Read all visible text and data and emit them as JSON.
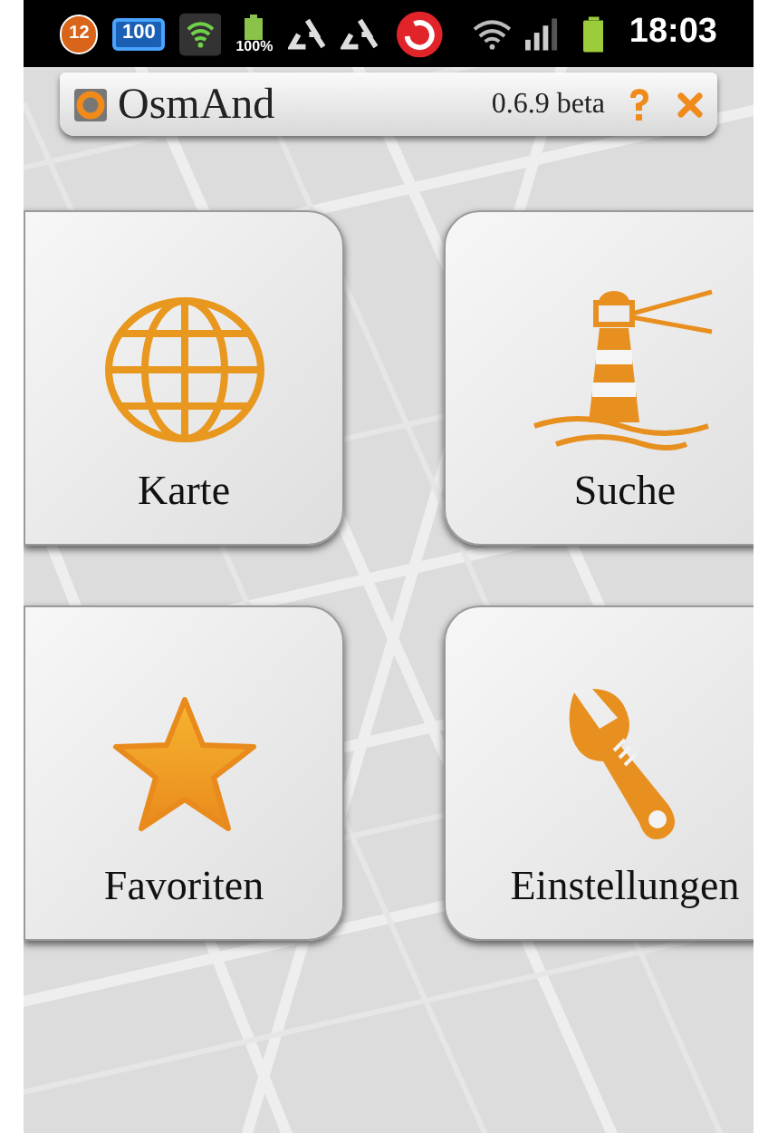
{
  "status_bar": {
    "notification_count": "12",
    "battery_app_level": "100",
    "battery_percent": "100%",
    "time": "18:03"
  },
  "title_bar": {
    "title": "OsmAnd",
    "version": "0.6.9 beta"
  },
  "tiles": [
    {
      "kind": "map",
      "label": "Karte"
    },
    {
      "kind": "search",
      "label": "Suche"
    },
    {
      "kind": "favorites",
      "label": "Favoriten"
    },
    {
      "kind": "settings",
      "label": "Einstellungen"
    }
  ]
}
